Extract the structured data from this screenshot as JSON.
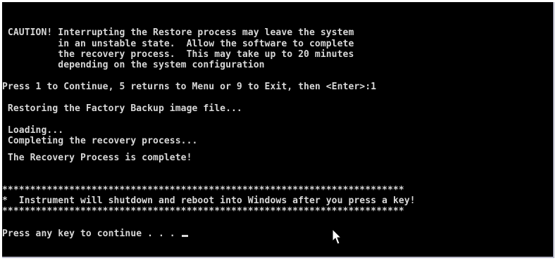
{
  "console": {
    "caution_lines": [
      " CAUTION! Interrupting the Restore process may leave the system",
      "          in an unstable state.  Allow the software to complete",
      "          the recovery process.  This may take up to 20 minutes",
      "          depending on the system configuration"
    ],
    "prompt_choice": "Press 1 to Continue, 5 returns to Menu or 9 to Exit, then <Enter>:1",
    "restoring": " Restoring the Factory Backup image file...",
    "loading": " Loading...",
    "completing": " Completing the recovery process...",
    "complete": " The Recovery Process is complete!",
    "stars_top": "************************************************************************",
    "notice": "*  Instrument will shutdown and reboot into Windows after you press a key!",
    "stars_bottom": "************************************************************************",
    "press_any_key": "Press any key to continue . . . "
  }
}
